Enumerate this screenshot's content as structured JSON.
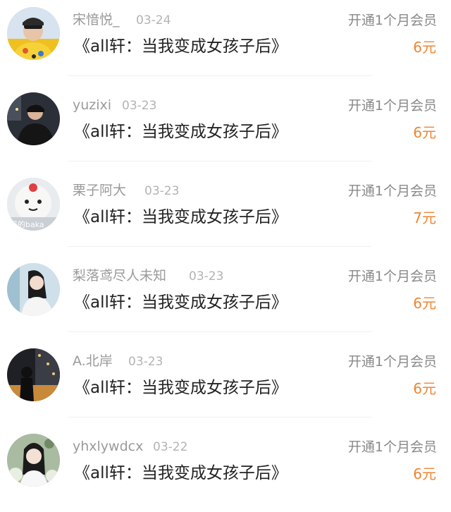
{
  "purchases": [
    {
      "username": "宋愔悦_",
      "date": "03-24",
      "action": "开通1个月会员",
      "book_title": "《all轩：当我变成女孩子后》",
      "price": "6元",
      "avatar_icon": "user-avatar-icon"
    },
    {
      "username": "yuzixi",
      "date": "03-23",
      "action": "开通1个月会员",
      "book_title": "《all轩：当我变成女孩子后》",
      "price": "6元",
      "avatar_icon": "user-avatar-icon"
    },
    {
      "username": "栗子阿大",
      "date": "03-23",
      "action": "开通1个月会员",
      "book_title": "《all轩：当我变成女孩子后》",
      "price": "7元",
      "avatar_icon": "user-avatar-icon"
    },
    {
      "username": "梨落鸢尽人未知",
      "date": "03-23",
      "action": "开通1个月会员",
      "book_title": "《all轩：当我变成女孩子后》",
      "price": "6元",
      "avatar_icon": "user-avatar-icon"
    },
    {
      "username": "A.北岸",
      "date": "03-23",
      "action": "开通1个月会员",
      "book_title": "《all轩：当我变成女孩子后》",
      "price": "6元",
      "avatar_icon": "user-avatar-icon"
    },
    {
      "username": "yhxlywdcx",
      "date": "03-22",
      "action": "开通1个月会员",
      "book_title": "《all轩：当我变成女孩子后》",
      "price": "6元",
      "avatar_icon": "user-avatar-icon"
    }
  ],
  "colors": {
    "price": "#ee8533",
    "username": "#9a9a9a",
    "date": "#b3b3b3",
    "action": "#888888",
    "title": "#222222"
  }
}
